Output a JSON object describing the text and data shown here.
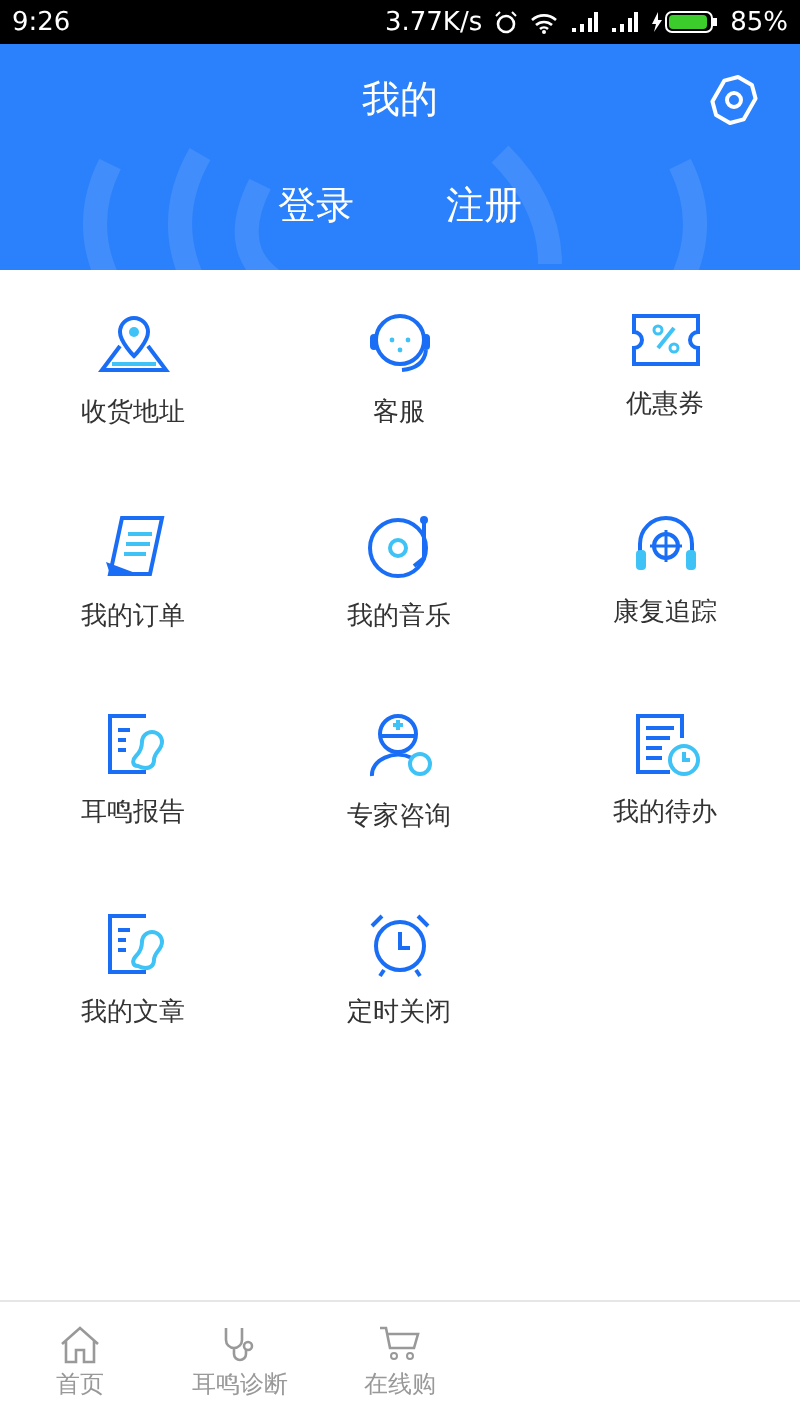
{
  "status_bar": {
    "time": "9:26",
    "speed": "3.77K/s",
    "battery": "85%"
  },
  "header": {
    "title": "我的",
    "actions": [
      "登录",
      "注册"
    ]
  },
  "grid": [
    {
      "label": "收货地址"
    },
    {
      "label": "客服"
    },
    {
      "label": "优惠券"
    },
    {
      "label": "我的订单"
    },
    {
      "label": "我的音乐"
    },
    {
      "label": "康复追踪"
    },
    {
      "label": "耳鸣报告"
    },
    {
      "label": "专家咨询"
    },
    {
      "label": "我的待办"
    },
    {
      "label": "我的文章"
    },
    {
      "label": "定时关闭"
    }
  ],
  "tab_bar": [
    {
      "label": "首页"
    },
    {
      "label": "耳鸣诊断"
    },
    {
      "label": "在线购"
    }
  ]
}
